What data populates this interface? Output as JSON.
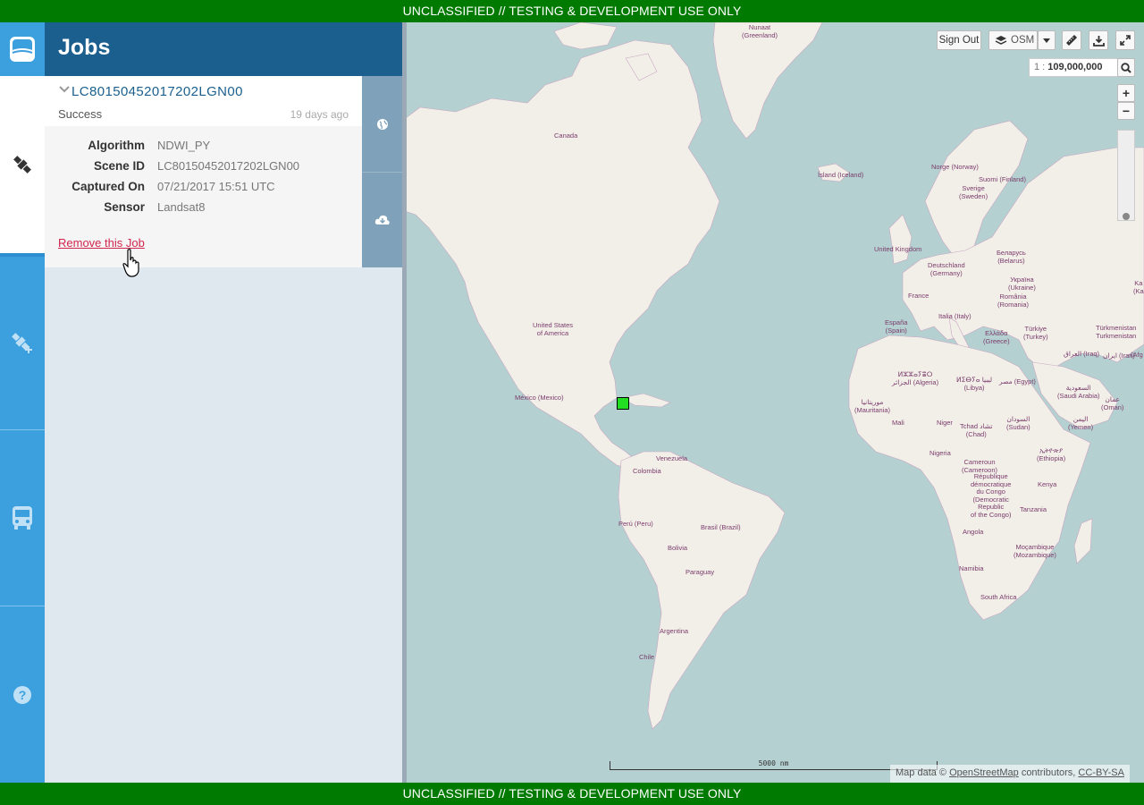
{
  "banner": {
    "top": "UNCLASSIFIED // TESTING & DEVELOPMENT USE ONLY",
    "bottom": "UNCLASSIFIED // TESTING & DEVELOPMENT USE ONLY"
  },
  "nav": {
    "items": [
      {
        "name": "jobs",
        "icon": "satellite-icon",
        "active": true
      },
      {
        "name": "create-job",
        "icon": "satellite-add-icon",
        "active": false
      },
      {
        "name": "product-lines",
        "icon": "bus-icon",
        "active": false
      },
      {
        "name": "help",
        "icon": "question-icon",
        "active": false
      }
    ]
  },
  "panel": {
    "title": "Jobs"
  },
  "job": {
    "name": "LC80150452017202LGN00",
    "status": "Success",
    "age": "19 days ago",
    "details": [
      {
        "label": "Algorithm",
        "value": "NDWI_PY"
      },
      {
        "label": "Scene ID",
        "value": "LC80150452017202LGN00"
      },
      {
        "label": "Captured On",
        "value": "07/21/2017 15:51 UTC"
      },
      {
        "label": "Sensor",
        "value": "Landsat8"
      }
    ],
    "remove_label": "Remove this Job",
    "actions": [
      {
        "icon": "globe-icon"
      },
      {
        "icon": "cloud-download-icon"
      }
    ]
  },
  "map": {
    "controls": {
      "sign_out": "Sign Out",
      "basemap": "OSM",
      "scale_prefix": "1 :",
      "scale_value": "109,000,000",
      "zoom_in": "+",
      "zoom_out": "−"
    },
    "scalebar": "5000 nm",
    "attribution": {
      "prefix": "Map data ©",
      "osm": "OpenStreetMap",
      "middle": "contributors,",
      "license": "CC-BY-SA"
    },
    "labels": [
      {
        "text": "Nunaat\n(Greenland)"
      },
      {
        "text": "Canada"
      },
      {
        "text": "Ísland (Iceland)"
      },
      {
        "text": "Norge (Norway)"
      },
      {
        "text": "Suomi (Finland)"
      },
      {
        "text": "Sverige\n(Sweden)"
      },
      {
        "text": "United Kingdom"
      },
      {
        "text": "Deutschland\n(Germany)"
      },
      {
        "text": "Беларусь\n(Belarus)"
      },
      {
        "text": "Україна\n(Ukraine)"
      },
      {
        "text": "France"
      },
      {
        "text": "România\n(Romania)"
      },
      {
        "text": "United States\nof America"
      },
      {
        "text": "España\n(Spain)"
      },
      {
        "text": "Italia (Italy)"
      },
      {
        "text": "Ελλάδα\n(Greece)"
      },
      {
        "text": "Türkiye\n(Turkey)"
      },
      {
        "text": "México (Mexico)"
      },
      {
        "text": "ⵍⵣⵣⴰⵢⴻⵔ\nالجزائر (Algeria)"
      },
      {
        "text": "ⵍⵉⴱⵢⴰ ليبيا\n(Libya)"
      },
      {
        "text": "مصر (Egypt)"
      },
      {
        "text": "السعودية\n(Saudi Arabia)"
      },
      {
        "text": "موريتانيا\n(Mauritania)"
      },
      {
        "text": "Mali"
      },
      {
        "text": "Niger"
      },
      {
        "text": "Tchad تشاد\n(Chad)"
      },
      {
        "text": "السودان\n(Sudan)"
      },
      {
        "text": "اليمن\n(Yemen)"
      },
      {
        "text": "عمان\n(Oman)"
      },
      {
        "text": "Venezuela"
      },
      {
        "text": "Colombia"
      },
      {
        "text": "Nigeria"
      },
      {
        "text": "ኢትዮጵያ\n(Ethiopia)"
      },
      {
        "text": "Cameroun\n(Cameroon)"
      },
      {
        "text": "République\ndémocratique\ndu Congo\n(Democratic\nRepublic\nof the Congo)"
      },
      {
        "text": "Kenya"
      },
      {
        "text": "Perú (Peru)"
      },
      {
        "text": "Brasil (Brazil)"
      },
      {
        "text": "Tanzania"
      },
      {
        "text": "Bolivia"
      },
      {
        "text": "Angola"
      },
      {
        "text": "Paraguay"
      },
      {
        "text": "Moçambique\n(Mozambique)"
      },
      {
        "text": "Namibia"
      },
      {
        "text": "Argentina"
      },
      {
        "text": "South Africa"
      },
      {
        "text": "Chile"
      },
      {
        "text": "Türkmenistan\nTurkmenistan"
      },
      {
        "text": "العراق (Iraq)"
      },
      {
        "text": "ایران (Iran)"
      },
      {
        "text": "Ka\n(Ka"
      },
      {
        "text": "(Afg"
      }
    ]
  }
}
